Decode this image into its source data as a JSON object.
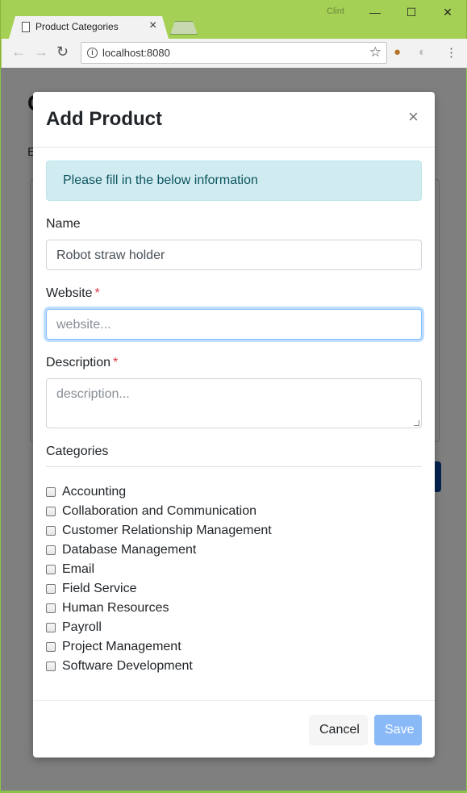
{
  "browser": {
    "tab_title": "Product Categories",
    "tab_close": "×",
    "user": "Clint",
    "url": "localhost:8080",
    "window_controls": {
      "minimize": "—",
      "maximize": "☐",
      "close": "✕"
    },
    "nav": {
      "back": "←",
      "forward": "→",
      "reload": "↻"
    },
    "star": "☆",
    "menu": "⋮"
  },
  "background": {
    "heading_fragment": "C",
    "text_fragment": "E"
  },
  "modal": {
    "title": "Add Product",
    "close": "×",
    "alert": "Please fill in the below information",
    "name_label": "Name",
    "name_value": "Robot straw holder",
    "website_label": "Website",
    "website_placeholder": "website...",
    "description_label": "Description",
    "description_placeholder": "description...",
    "required_marker": "*",
    "categories_label": "Categories",
    "categories": [
      "Accounting",
      "Collaboration and Communication",
      "Customer Relationship Management",
      "Database Management",
      "Email",
      "Field Service",
      "Human Resources",
      "Payroll",
      "Project Management",
      "Software Development"
    ],
    "cancel_label": "Cancel",
    "save_label": "Save"
  },
  "colors": {
    "chrome": "#a5d056",
    "alert_bg": "#d1ecf1",
    "required": "#dc3545",
    "save_button": "#8ab9f8"
  }
}
